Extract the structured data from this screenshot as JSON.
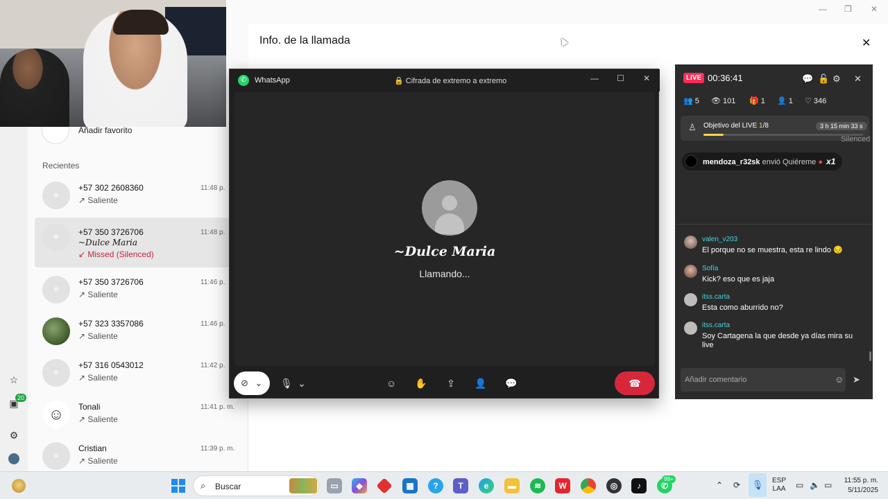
{
  "calls_window": {
    "favorite_label": "Añadir favorito",
    "recents_title": "Recientes",
    "rail_badge": "20",
    "calls": [
      {
        "name": "+57 302 2608360",
        "sub": "Saliente",
        "time": "11:48 p.",
        "selected": false,
        "missed": false,
        "avatar": "default"
      },
      {
        "name": "+57 350 3726706",
        "alias": "~Dulce Maria",
        "sub": "Missed (Silenced)",
        "time": "11:48 p.",
        "selected": true,
        "missed": true,
        "avatar": "default"
      },
      {
        "name": "+57 350 3726706",
        "sub": "Saliente",
        "time": "11:46 p.",
        "selected": false,
        "missed": false,
        "avatar": "default"
      },
      {
        "name": "+57 323 3357086",
        "sub": "Saliente",
        "time": "11:46 p.",
        "selected": false,
        "missed": false,
        "avatar": "photo"
      },
      {
        "name": "+57 316 0543012",
        "sub": "Saliente",
        "time": "11:42 p.",
        "selected": false,
        "missed": false,
        "avatar": "default"
      },
      {
        "name": "Tonali",
        "sub": "Saliente",
        "time": "11:41 p. m.",
        "selected": false,
        "missed": false,
        "avatar": "emoji"
      },
      {
        "name": "Cristian",
        "sub": "Saliente",
        "time": "11:39 p. m.",
        "selected": false,
        "missed": false,
        "avatar": "default"
      }
    ]
  },
  "info_panel": {
    "title": "Info. de la llamada"
  },
  "call_window": {
    "app_name": "WhatsApp",
    "encryption": "Cifrada de extremo a extremo",
    "callee_name": "~Dulce Maria",
    "status": "Llamando..."
  },
  "live": {
    "badge": "LIVE",
    "timer": "00:36:41",
    "stats": {
      "members": "5",
      "views": "101",
      "gifts": "1",
      "guests": "1",
      "likes": "346"
    },
    "goal": {
      "label": "Objetivo del LIVE",
      "current": "1",
      "total": "/8",
      "time_left": "3 h 15 min 33 s",
      "ghost_text": "Silenced",
      "progress_fraction": 0.125
    },
    "gift": {
      "user": "mendoza_r32sk",
      "text": "envió Quiéreme",
      "count": "x1"
    },
    "comments": [
      {
        "user": "valen_v203",
        "text": "El porque no se muestra, esta re lindo 😔",
        "avatar": "a1"
      },
      {
        "user": "Sofía",
        "text": "Kick? eso que es jaja",
        "avatar": "a2"
      },
      {
        "user": "itss.carta",
        "text": "Esta como aburrido no?",
        "avatar": "default"
      },
      {
        "user": "itss.carta",
        "text": "Soy Cartagena la que desde ya días mira su live",
        "avatar": "default"
      }
    ],
    "input_placeholder": "Añadir comentario"
  },
  "taskbar": {
    "search_label": "Buscar",
    "whatsapp_badge": "99+",
    "language": "ESP",
    "layout": "LAA",
    "time": "11:55 p. m.",
    "date": "5/11/2025"
  },
  "colors": {
    "whatsapp_green": "#25d366",
    "end_call_red": "#d7273b",
    "live_pink": "#fe2c55",
    "comment_user_cyan": "#46d6e0",
    "goal_yellow": "#ffd54a",
    "missed_red": "#c2263a"
  }
}
